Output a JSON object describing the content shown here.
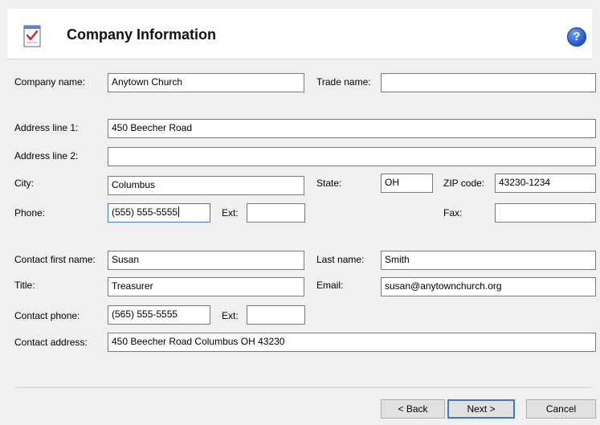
{
  "header": {
    "title": "Company Information",
    "help_icon": "help-icon"
  },
  "company": {
    "company_name_label": "Company name:",
    "company_name_value": "Anytown Church",
    "trade_name_label": "Trade name:",
    "trade_name_value": ""
  },
  "address": {
    "line1_label": "Address line 1:",
    "line1_value": "450 Beecher Road",
    "line2_label": "Address line 2:",
    "line2_value": "",
    "city_label": "City:",
    "city_value": "Columbus",
    "state_label": "State:",
    "state_value": "OH",
    "zip_label": "ZIP code:",
    "zip_value": "43230-1234",
    "phone_label": "Phone:",
    "phone_value": "(555) 555-5555",
    "ext_label": "Ext:",
    "ext_value": "",
    "fax_label": "Fax:",
    "fax_value": ""
  },
  "contact": {
    "first_name_label": "Contact first name:",
    "first_name_value": "Susan",
    "last_name_label": "Last name:",
    "last_name_value": "Smith",
    "title_label": "Title:",
    "title_value": "Treasurer",
    "email_label": "Email:",
    "email_value": "susan@anytownchurch.org",
    "phone_label": "Contact phone:",
    "phone_value": "(565) 555-5555",
    "ext_label": "Ext:",
    "ext_value": "",
    "address_label": "Contact address:",
    "address_value": "450 Beecher Road Columbus OH 43230"
  },
  "buttons": {
    "back": "< Back",
    "next": "Next >",
    "cancel": "Cancel"
  },
  "colors": {
    "focus_border": "#3b7ad4",
    "help_icon": "#1f56c8"
  }
}
